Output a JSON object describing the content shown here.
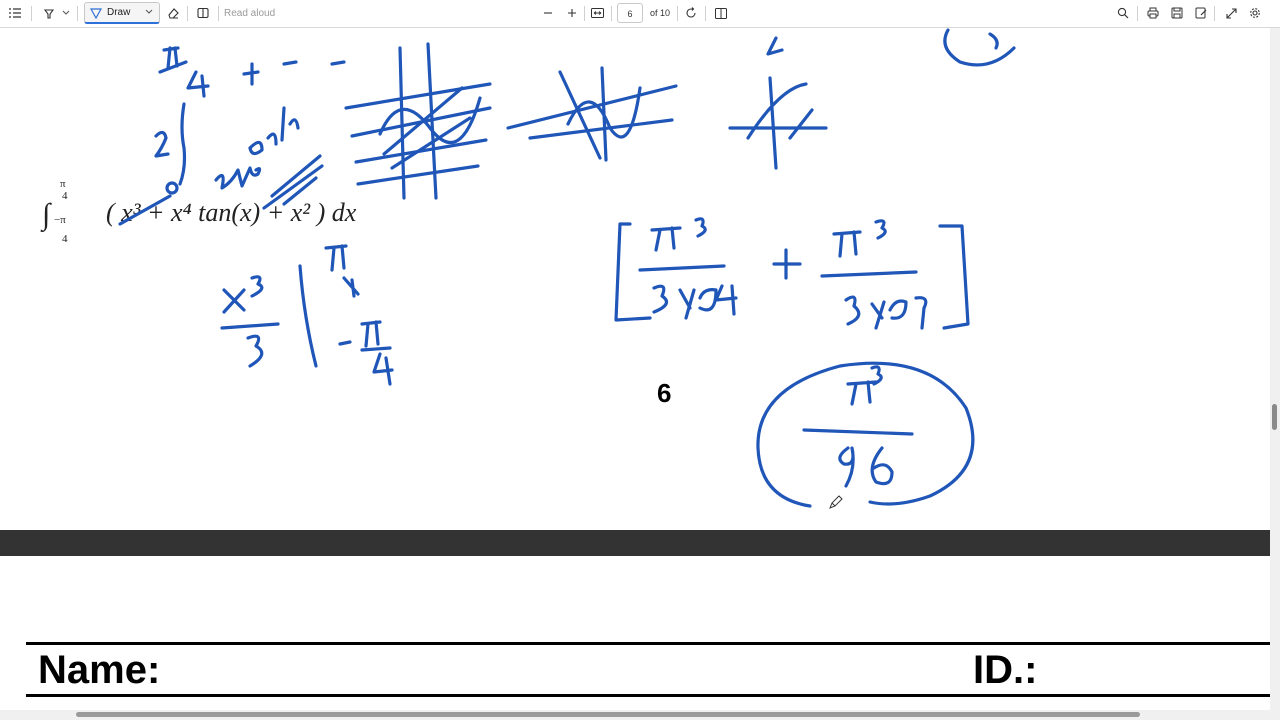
{
  "toolbar": {
    "draw_label": "Draw",
    "read_aloud_label": "Read aloud",
    "current_page": "6",
    "page_total": "of 10"
  },
  "page": {
    "question_number": "6",
    "integral": {
      "upper_limit_num": "π",
      "upper_limit_den": "4",
      "lower_limit_num": "−π",
      "lower_limit_den": "4",
      "integrand": "( x³ + x⁴ tan(x) + x² ) dx"
    },
    "handwriting_color": "#1f56b8"
  },
  "footer": {
    "name_label": "Name:",
    "id_label": "ID.:"
  },
  "icons": {
    "toolbar": [
      "contents-icon",
      "highlight-icon",
      "draw-icon",
      "erase-icon",
      "view-icon",
      "zoom-out-icon",
      "zoom-in-icon",
      "fit-page-icon",
      "rotate-icon",
      "page-view-icon",
      "search-icon",
      "print-icon",
      "save-icon",
      "save-as-icon",
      "fullscreen-icon",
      "settings-icon"
    ]
  }
}
